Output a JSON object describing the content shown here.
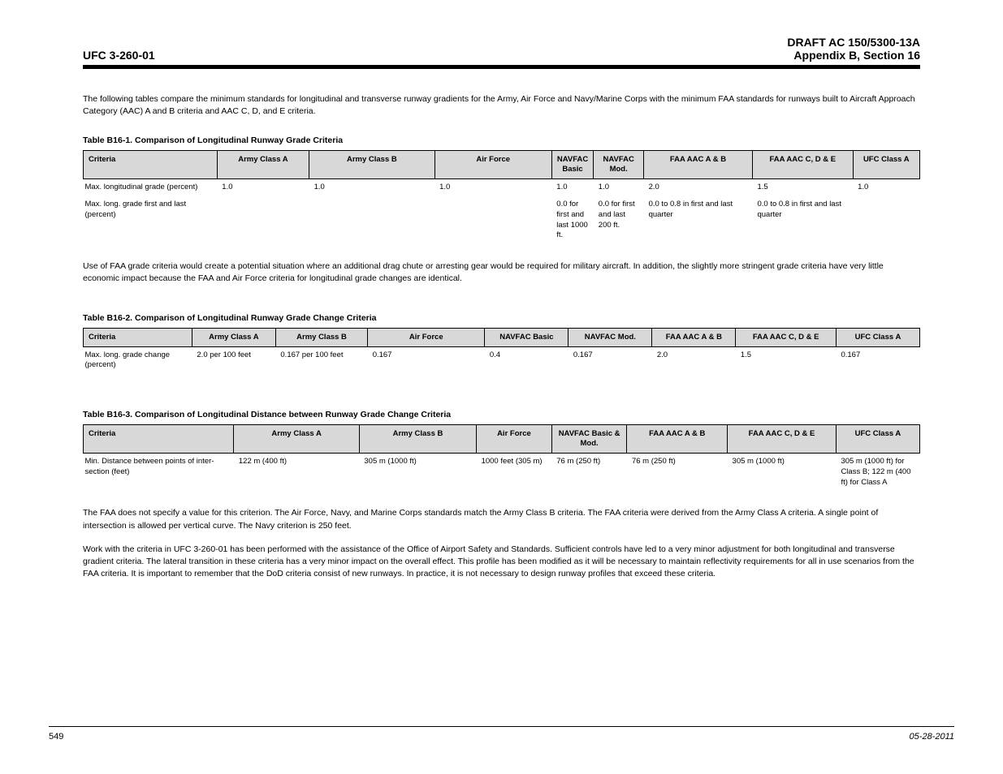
{
  "header": {
    "left": "UFC 3-260-01",
    "right_line1": "DRAFT AC 150/5300-13A",
    "right_line2": "Appendix B, Section 16"
  },
  "intro": "The following tables compare the minimum standards for longitudinal and transverse runway gradients for the Army, Air Force and Navy/Marine Corps with the minimum FAA standards for runways built to Aircraft Approach Category (AAC) A and B criteria and AAC C, D, and E criteria.",
  "table1": {
    "title": "Table B16-1. Comparison of Longitudinal Runway Grade Criteria",
    "headers": [
      "Criteria",
      "Army Class A",
      "Army Class B",
      "Air Force",
      "NAVFAC Basic",
      "NAVFAC Mod.",
      "FAA AAC A & B",
      "FAA AAC C, D & E",
      "UFC Class A"
    ],
    "rows": [
      [
        "Max. longitudinal grade (percent)",
        "1.0",
        "1.0",
        "1.0",
        "1.0",
        "1.0",
        "2.0",
        "1.5",
        "1.0"
      ],
      [
        "Max. long. grade first and last (percent)",
        "",
        "",
        "",
        "0.0 for first and last 1000 ft.",
        "0.0 for first and last 200 ft.",
        "0.0 to 0.8 in first and last quarter",
        "0.0 to 0.8 in first and last quarter",
        ""
      ]
    ]
  },
  "para_after_t1": "Use of FAA grade criteria would create a potential situation where an additional drag chute or arresting gear would be required for military aircraft. In addition, the slightly more stringent grade criteria have very little economic impact because the FAA and Air Force criteria for longitudinal grade changes are identical.",
  "table2": {
    "title": "Table B16-2. Comparison of Longitudinal Runway Grade Change Criteria",
    "headers": [
      "Criteria",
      "Army Class A",
      "Army Class B",
      "Air Force",
      "NAVFAC Basic",
      "NAVFAC Mod.",
      "FAA AAC A & B",
      "FAA AAC C, D & E",
      "UFC Class A"
    ],
    "rows": [
      [
        "Max. long. grade change (percent)",
        "2.0 per 100 feet",
        "0.167 per 100 feet",
        "0.167",
        "0.4",
        "0.167",
        "2.0",
        "1.5",
        "0.167"
      ]
    ]
  },
  "table3": {
    "title": "Table B16-3. Comparison of Longitudinal Distance between Runway Grade Change Criteria",
    "headers": [
      "Criteria",
      "Army Class A",
      "Army Class B",
      "Air Force",
      "NAVFAC Basic & Mod.",
      "FAA AAC A & B",
      "FAA AAC C, D & E",
      "UFC Class A"
    ],
    "rows": [
      [
        "Min. Distance between points of inter-section (feet)",
        "122 m (400 ft)",
        "305 m (1000 ft)",
        "1000 feet (305 m)",
        "76 m (250 ft)",
        "76 m (250 ft)",
        "305 m (1000 ft)",
        "305 m (1000 ft) for Class B; 122 m (400 ft) for Class A"
      ]
    ]
  },
  "closing_paras": [
    "The FAA does not specify a value for this criterion. The Air Force, Navy, and Marine Corps standards match the Army Class B criteria. The FAA criteria were derived from the Army Class A criteria. A single point of intersection is allowed per vertical curve. The Navy criterion is 250 feet.",
    "Work with the criteria in UFC 3-260-01 has been performed with the assistance of the Office of Airport Safety and Standards. Sufficient controls have led to a very minor adjustment for both longitudinal and transverse gradient criteria. The lateral transition in these criteria has a very minor impact on the overall effect. This profile has been modified as it will be necessary to maintain reflectivity requirements for all in use scenarios from the FAA criteria. It is important to remember that the DoD criteria consist of new runways. In practice, it is not necessary to design runway profiles that exceed these criteria."
  ],
  "footer": {
    "page": "549",
    "date": "05-28-2011"
  }
}
